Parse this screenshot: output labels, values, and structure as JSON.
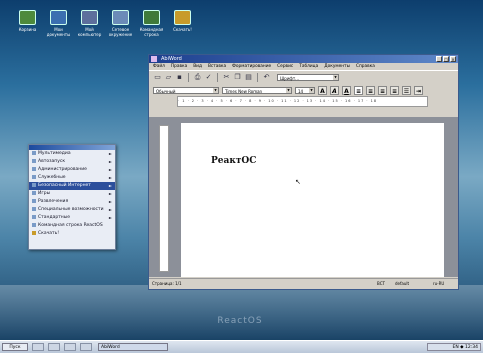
{
  "desktop": {
    "icons": [
      {
        "label": "Корзина",
        "color": "#4d8a3c"
      },
      {
        "label": "Мои документы",
        "color": "#3b6fb0"
      },
      {
        "label": "Мой компьютер",
        "color": "#5d6f9c"
      },
      {
        "label": "Сетевое окружение",
        "color": "#6b8bb8"
      },
      {
        "label": "Командная строка",
        "color": "#3f7a3a"
      },
      {
        "label": "Скачать!",
        "color": "#c89b2a"
      }
    ],
    "brand": "ReactOS"
  },
  "start_menu": {
    "items": [
      {
        "label": "Мультимедиа",
        "arrow": "►"
      },
      {
        "label": "Автозапуск",
        "arrow": "►"
      },
      {
        "label": "Администрирование",
        "arrow": "►"
      },
      {
        "label": "Служебные",
        "arrow": "►"
      },
      {
        "label": "Безопасный Интернет",
        "arrow": "►"
      },
      {
        "label": "Игры",
        "arrow": "►"
      },
      {
        "label": "Развлечения",
        "arrow": "►"
      },
      {
        "label": "Специальные возможности",
        "arrow": "►"
      },
      {
        "label": "Стандартные",
        "arrow": "►"
      },
      {
        "label": "Командная строка ReactOS",
        "arrow": ""
      },
      {
        "label": "Скачать!",
        "arrow": ""
      }
    ],
    "selected_index": 4
  },
  "window": {
    "title": "AbiWord",
    "menu": [
      "Файл",
      "Правка",
      "Вид",
      "Вставка",
      "Форматирование",
      "Сервис",
      "Таблица",
      "Документы",
      "Справка"
    ],
    "toolbar_icons": [
      "new-icon",
      "open-icon",
      "save-icon",
      "print-icon",
      "cut-icon",
      "copy-icon",
      "paste-icon"
    ],
    "style_combo": "Обычный",
    "font_combo": "Times New Roman",
    "size_combo": "14",
    "zoom_combo": "Шрифт...",
    "bold": "A",
    "italic": "A",
    "underline": "A",
    "ruler": "· 1 · 2 · 3 · 4 · 5 · 6 · 7 · 8 · 9 · 10 · 11 · 12 · 13 · 14 · 15 · 16 · 17 · 18",
    "document_text": "РеактОС",
    "status": {
      "page": "Страница: 1/1",
      "mode": "ВСТ",
      "lang": "default",
      "extra": "ru-RU"
    }
  },
  "taskbar": {
    "start_label": "Пуск",
    "task_label": "AbiWord",
    "tray": "EN ◆ 12:34"
  }
}
